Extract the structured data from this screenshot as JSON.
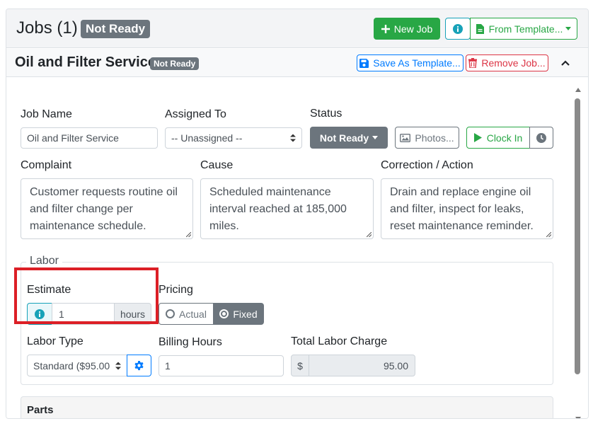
{
  "jobs_panel": {
    "title": "Jobs (1)",
    "status_badge": "Not Ready",
    "new_job_label": "New Job",
    "from_template_label": "From Template..."
  },
  "job": {
    "title": "Oil and Filter Service",
    "status_badge": "Not Ready",
    "save_template_label": "Save As Template...",
    "remove_label": "Remove Job...",
    "fields": {
      "job_name_label": "Job Name",
      "job_name_value": "Oil and Filter Service",
      "assigned_to_label": "Assigned To",
      "assigned_to_value": "-- Unassigned --",
      "status_label": "Status",
      "status_value": "Not Ready",
      "photos_label": "Photos...",
      "clock_in_label": "Clock In"
    },
    "complaint": {
      "label": "Complaint",
      "value": "Customer requests routine oil and filter change per maintenance schedule."
    },
    "cause": {
      "label": "Cause",
      "value": "Scheduled maintenance interval reached at 185,000 miles."
    },
    "correction": {
      "label": "Correction / Action",
      "value": "Drain and replace engine oil and filter, inspect for leaks, reset maintenance reminder."
    }
  },
  "labor": {
    "legend": "Labor",
    "estimate_label": "Estimate",
    "estimate_value": "1",
    "estimate_unit": "hours",
    "pricing_label": "Pricing",
    "pricing_options": [
      "Actual",
      "Fixed"
    ],
    "pricing_selected": "Fixed",
    "labor_type_label": "Labor Type",
    "labor_type_value": "Standard ($95.00",
    "billing_hours_label": "Billing Hours",
    "billing_hours_value": "1",
    "total_label": "Total Labor Charge",
    "currency_symbol": "$",
    "total_value": "95.00"
  },
  "parts": {
    "title": "Parts"
  },
  "colors": {
    "success": "#28a745",
    "primary": "#007bff",
    "danger": "#dc3545",
    "info": "#17a2b8",
    "secondary": "#6c757d",
    "highlight": "#dc1f26"
  },
  "icons": [
    "plus-icon",
    "info-icon",
    "file-icon",
    "chevron-down-icon",
    "save-icon",
    "trash-icon",
    "chevron-up-icon",
    "caret-down-icon",
    "image-icon",
    "play-icon",
    "clock-icon",
    "gear-icon"
  ]
}
